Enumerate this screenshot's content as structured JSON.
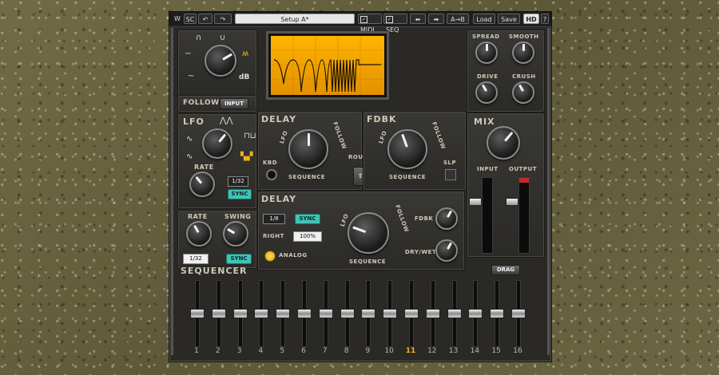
{
  "topbar": {
    "sc": "SC",
    "preset": "Setup A*",
    "midi": "MIDI",
    "seq": "SEQ",
    "ab": "A→B",
    "load": "Load",
    "save": "Save",
    "hd": "HD",
    "help": "?"
  },
  "filter": {
    "follow_label": "FOLLOW",
    "input_button": "INPUT",
    "db_label": "dB"
  },
  "lfo": {
    "title": "LFO",
    "rate_label": "RATE",
    "rate_value": "1/32",
    "sync": "SYNC"
  },
  "swing": {
    "rate_label": "RATE",
    "swing_label": "SWING",
    "rate_value": "1/32",
    "sync": "SYNC"
  },
  "delay_top": {
    "title": "DELAY",
    "lfo": "LFO",
    "follow": "FOLLOW",
    "sequence": "SEQUENCE",
    "kbd": "KBD"
  },
  "fdbk_top": {
    "title": "FDBK",
    "lfo": "LFO",
    "follow": "FOLLOW",
    "sequence": "SEQUENCE",
    "slp": "SLP"
  },
  "route": {
    "label": "ROUTE"
  },
  "delay": {
    "title": "DELAY",
    "time_value": "1/8",
    "sync": "SYNC",
    "right_label": "RIGHT",
    "right_value": "100%",
    "analog": "ANALOG",
    "lfo": "LFO",
    "follow": "FOLLOW",
    "sequence": "SEQUENCE",
    "fdbk": "FDBK",
    "drywet": "DRY/WET"
  },
  "right": {
    "spread": "SPREAD",
    "smooth": "SMOOTH",
    "drive": "DRIVE",
    "crush": "CRUSH",
    "mix": "MIX",
    "input": "INPUT",
    "output": "OUTPUT"
  },
  "sequencer": {
    "title": "SEQUENCER",
    "drag": "DRAG",
    "steps": [
      "1",
      "2",
      "3",
      "4",
      "5",
      "6",
      "7",
      "8",
      "9",
      "10",
      "11",
      "12",
      "13",
      "14",
      "15",
      "16"
    ],
    "active_step": "11",
    "values": [
      0.5,
      0.5,
      0.5,
      0.5,
      0.5,
      0.5,
      0.5,
      0.5,
      0.5,
      0.5,
      0.5,
      0.5,
      0.5,
      0.5,
      0.5,
      0.5
    ]
  },
  "colors": {
    "accent": "#3fc4b6",
    "screen": "#ffb400",
    "active_step": "#f2b21a"
  }
}
